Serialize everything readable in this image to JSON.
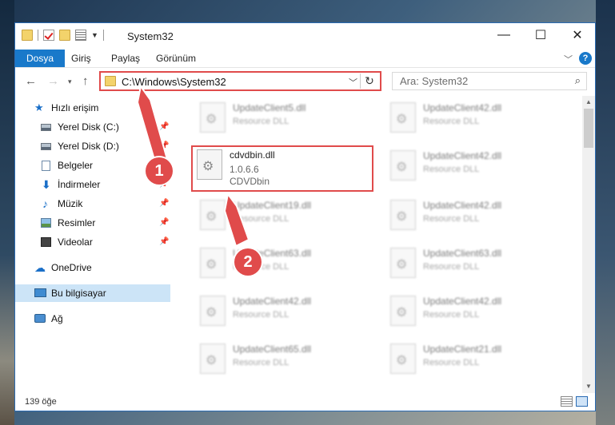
{
  "window": {
    "title": "System32",
    "controls": {
      "minimize": "—",
      "maximize": "☐",
      "close": "✕"
    }
  },
  "ribbon": {
    "tabs": [
      "Dosya",
      "Giriş",
      "Paylaş",
      "Görünüm"
    ],
    "help": "?"
  },
  "address": {
    "path": "C:\\Windows\\System32",
    "refresh_icon": "↻"
  },
  "search": {
    "placeholder": "Ara: System32"
  },
  "sidebar": {
    "items": [
      {
        "label": "Hızlı erişim",
        "icon": "star-icon"
      },
      {
        "label": "Yerel Disk (C:)",
        "icon": "drive-icon",
        "pinned": true
      },
      {
        "label": "Yerel Disk (D:)",
        "icon": "drive-icon",
        "pinned": true
      },
      {
        "label": "Belgeler",
        "icon": "documents-icon",
        "pinned": true
      },
      {
        "label": "İndirmeler",
        "icon": "downloads-icon",
        "pinned": true
      },
      {
        "label": "Müzik",
        "icon": "music-icon",
        "pinned": true
      },
      {
        "label": "Resimler",
        "icon": "pictures-icon",
        "pinned": true
      },
      {
        "label": "Videolar",
        "icon": "videos-icon",
        "pinned": true
      },
      {
        "label": "OneDrive",
        "icon": "onedrive-icon"
      },
      {
        "label": "Bu bilgisayar",
        "icon": "this-pc-icon",
        "selected": true
      },
      {
        "label": "Ağ",
        "icon": "network-icon"
      }
    ]
  },
  "files": {
    "highlighted": {
      "name": "cdvdbin.dll",
      "version": "1.0.6.6",
      "company": "CDVDbin"
    },
    "left_column": [
      {
        "name": "UpdateClient5.dll",
        "desc": "Resource DLL"
      },
      {
        "name": "UpdateClient19.dll",
        "desc": "Resource DLL"
      },
      {
        "name": "UpdateClient63.dll",
        "desc": "Resource DLL"
      },
      {
        "name": "UpdateClient42.dll",
        "desc": "Resource DLL"
      },
      {
        "name": "UpdateClient65.dll",
        "desc": "Resource DLL"
      }
    ],
    "right_column": [
      {
        "name": "UpdateClient42.dll",
        "desc": "Resource DLL"
      },
      {
        "name": "UpdateClient42.dll",
        "desc": "Resource DLL"
      },
      {
        "name": "UpdateClient42.dll",
        "desc": "Resource DLL"
      },
      {
        "name": "UpdateClient63.dll",
        "desc": "Resource DLL"
      },
      {
        "name": "UpdateClient42.dll",
        "desc": "Resource DLL"
      },
      {
        "name": "UpdateClient21.dll",
        "desc": "Resource DLL"
      }
    ]
  },
  "status": {
    "count": "139 öğe"
  },
  "callouts": {
    "first": "1",
    "second": "2"
  },
  "colors": {
    "accent": "#1979ca",
    "callout": "#e04b4b",
    "selection": "#cce4f7"
  }
}
